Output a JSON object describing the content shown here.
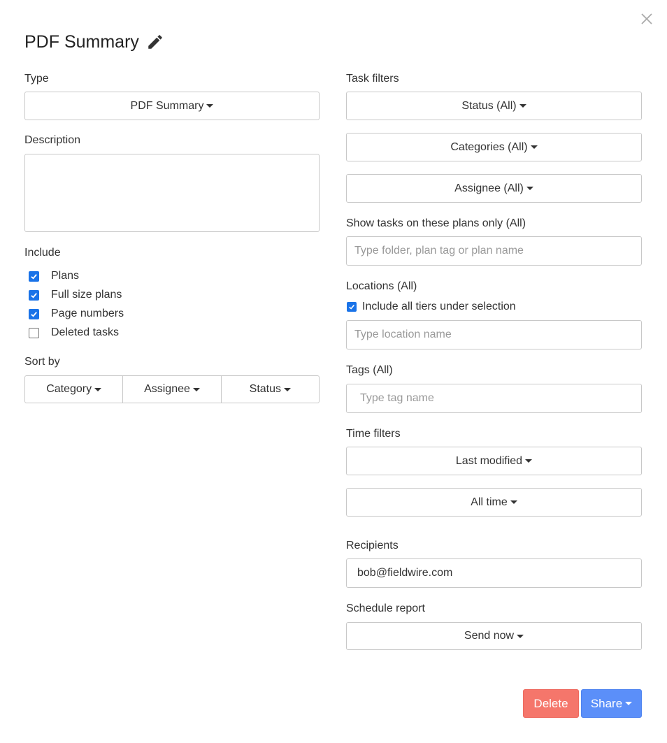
{
  "dialog": {
    "title": "PDF Summary",
    "close_icon": "close-icon",
    "edit_icon": "pencil-icon"
  },
  "left": {
    "type_label": "Type",
    "type_value": "PDF Summary",
    "description_label": "Description",
    "description_value": "",
    "include_label": "Include",
    "include_items": [
      {
        "label": "Plans",
        "checked": true
      },
      {
        "label": "Full size plans",
        "checked": true
      },
      {
        "label": "Page numbers",
        "checked": true
      },
      {
        "label": "Deleted tasks",
        "checked": false
      }
    ],
    "sort_label": "Sort by",
    "sort_options": [
      "Category",
      "Assignee",
      "Status"
    ]
  },
  "right": {
    "task_filters_label": "Task filters",
    "status_filter": "Status (All)",
    "categories_filter": "Categories (All)",
    "assignee_filter": "Assignee (All)",
    "plans_label": "Show tasks on these plans only (All)",
    "plans_placeholder": "Type folder, plan tag or plan name",
    "locations_label": "Locations (All)",
    "include_tiers_label": "Include all tiers under selection",
    "include_tiers_checked": true,
    "location_placeholder": "Type location name",
    "tags_label": "Tags (All)",
    "tags_placeholder": "Type tag name",
    "time_filters_label": "Time filters",
    "time_filter_field": "Last modified",
    "time_filter_range": "All time",
    "recipients_label": "Recipients",
    "recipients_value": "bob@fieldwire.com",
    "schedule_label": "Schedule report",
    "schedule_value": "Send now"
  },
  "footer": {
    "delete_label": "Delete",
    "share_label": "Share"
  },
  "colors": {
    "delete_bg": "#f5766b",
    "share_bg": "#5b8ff9",
    "checkbox": "#1a73e8"
  }
}
